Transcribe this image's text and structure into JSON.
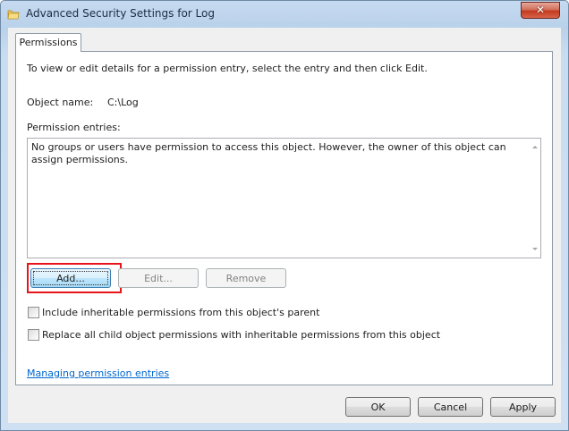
{
  "window": {
    "title": "Advanced Security Settings for Log",
    "close_symbol": "✕"
  },
  "tabs": [
    {
      "label": "Permissions",
      "selected": true
    }
  ],
  "content": {
    "instruction": "To view or edit details for a permission entry, select the entry and then click Edit.",
    "object_name_label": "Object name:",
    "object_name_value": "C:\\Log",
    "entries_label": "Permission entries:",
    "entries_message": "No groups or users have permission to access this object. However, the owner of this object can assign permissions."
  },
  "entry_buttons": {
    "add": "Add...",
    "edit": "Edit...",
    "remove": "Remove"
  },
  "options": {
    "include_inheritable": {
      "label": "Include inheritable permissions from this object's parent",
      "checked": false
    },
    "replace_child": {
      "label": "Replace all child object permissions with inheritable permissions from this object",
      "checked": false
    }
  },
  "help_link": "Managing permission entries",
  "footer": {
    "ok": "OK",
    "cancel": "Cancel",
    "apply": "Apply"
  },
  "icons": {
    "title_icon": "folder-icon",
    "close_icon": "close-icon"
  },
  "colors": {
    "highlight": "#e8141b",
    "link": "#0066cc",
    "close_button": "#c23b20"
  }
}
